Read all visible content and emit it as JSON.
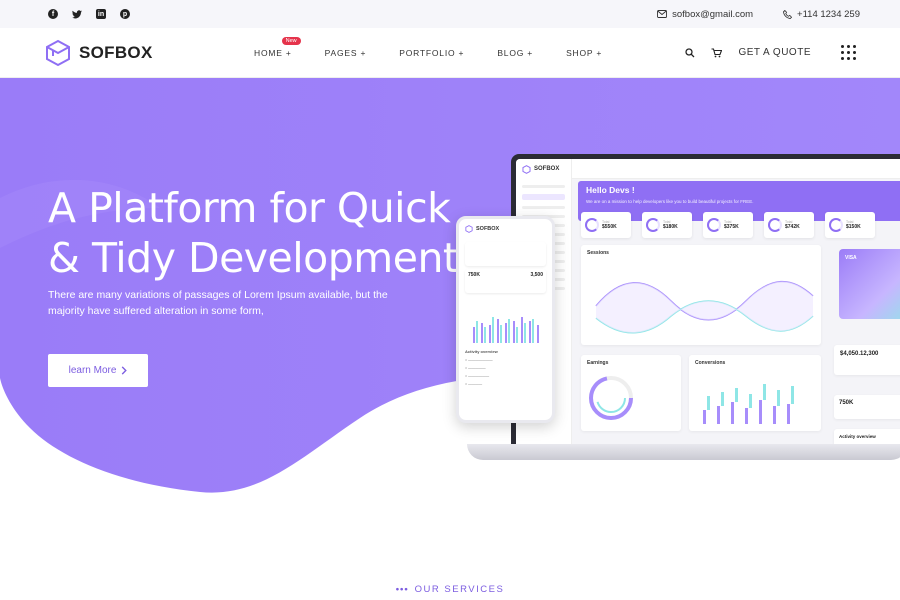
{
  "topbar": {
    "social_icons": [
      "facebook-icon",
      "twitter-icon",
      "linkedin-icon",
      "pinterest-icon"
    ],
    "email": "sofbox@gmail.com",
    "phone": "+114 1234 259"
  },
  "nav": {
    "logo_text": "SOFBOX",
    "menu": [
      {
        "label": "HOME +",
        "badge": "New"
      },
      {
        "label": "PAGES +"
      },
      {
        "label": "PORTFOLIO +"
      },
      {
        "label": "BLOG +"
      },
      {
        "label": "SHOP +"
      }
    ],
    "quote_label": "GET A QUOTE"
  },
  "hero": {
    "title": "A Platform for Quick & Tidy Development",
    "subtitle": "There are many variations of passages of Lorem Ipsum available, but the majority have suffered alteration in some form,",
    "button_label": "learn More",
    "button_icon": "chevron-right-icon"
  },
  "mockup": {
    "logo_text": "SOFBOX",
    "banner_title": "Hello Devs !",
    "banner_text": "We are on a mission to help developers like you to build beautiful projects for FREE.",
    "stats": [
      "$550K",
      "$180K",
      "$375K",
      "$742K",
      "$150K"
    ],
    "chart_title": "Sessions",
    "earnings_title": "Earnings",
    "conversions_title": "Conversions",
    "card_brand": "VISA",
    "balance": "$4,050.12,300",
    "balance_small": "750K",
    "activity_title": "Activity overview",
    "phone_stat_a": "750K",
    "phone_stat_b": "3,500",
    "phone_activity_title": "Activity overview"
  },
  "services": {
    "dots": "•••",
    "label": "OUR SERVICES"
  },
  "colors": {
    "accent": "#9d80f8",
    "accent_dark": "#7c5de0",
    "badge_red": "#e5334b",
    "teal": "#8ee6e6"
  }
}
